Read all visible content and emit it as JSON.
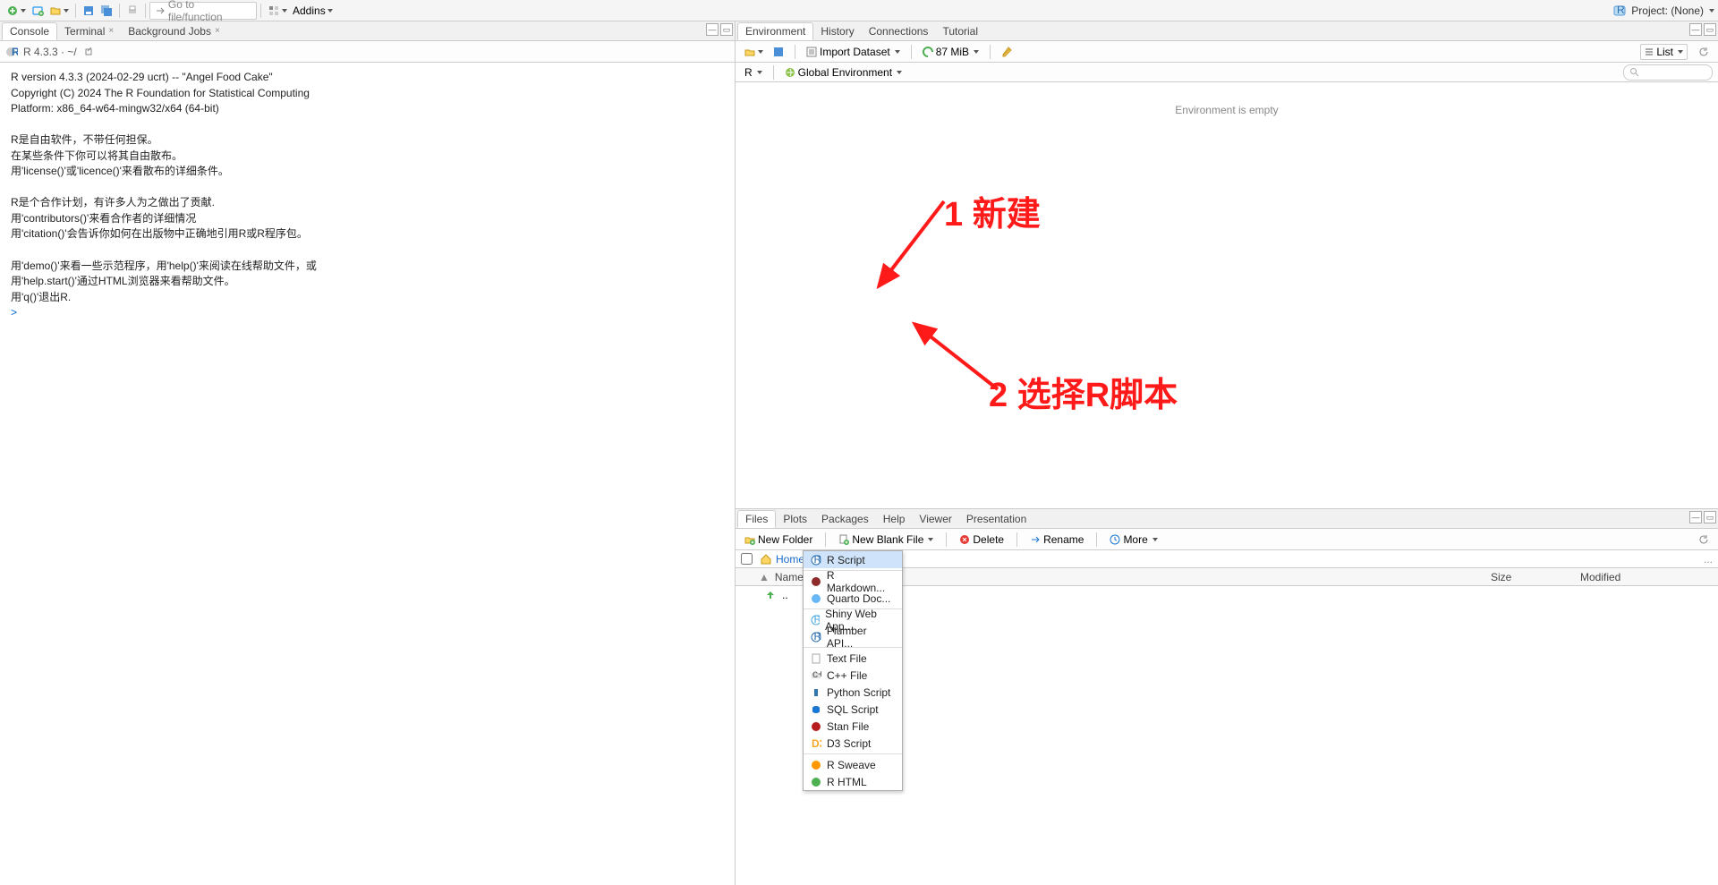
{
  "topbar": {
    "goto_placeholder": "Go to file/function",
    "addins": "Addins",
    "project": "Project: (None)"
  },
  "left_tabs": [
    "Console",
    "Terminal",
    "Background Jobs"
  ],
  "console_header": {
    "r_version_short": "R 4.3.3 · ~/"
  },
  "console_text": "R version 4.3.3 (2024-02-29 ucrt) -- \"Angel Food Cake\"\nCopyright (C) 2024 The R Foundation for Statistical Computing\nPlatform: x86_64-w64-mingw32/x64 (64-bit)\n\nR是自由软件，不带任何担保。\n在某些条件下你可以将其自由散布。\n用'license()'或'licence()'来看散布的详细条件。\n\nR是个合作计划，有许多人为之做出了贡献.\n用'contributors()'来看合作者的详细情况\n用'citation()'会告诉你如何在出版物中正确地引用R或R程序包。\n\n用'demo()'来看一些示范程序，用'help()'来阅读在线帮助文件，或\n用'help.start()'通过HTML浏览器来看帮助文件。\n用'q()'退出R.\n",
  "prompt": "> ",
  "env_tabs": [
    "Environment",
    "History",
    "Connections",
    "Tutorial"
  ],
  "env_toolbar": {
    "import": "Import Dataset",
    "mem": "87 MiB"
  },
  "env_toolbar2": {
    "scope": "R",
    "env_sel": "Global Environment"
  },
  "env_empty": "Environment is empty",
  "env_list_btn": "List",
  "files_tabs": [
    "Files",
    "Plots",
    "Packages",
    "Help",
    "Viewer",
    "Presentation"
  ],
  "files_toolbar": {
    "new_folder": "New Folder",
    "new_blank": "New Blank File",
    "delete": "Delete",
    "rename": "Rename",
    "more": "More"
  },
  "breadcrumb": {
    "home": "Home"
  },
  "file_headers": {
    "name": "Name",
    "size": "Size",
    "modified": "Modified"
  },
  "file_row_up": "..",
  "dropdown_items": [
    "R Script",
    "R Markdown...",
    "Quarto Doc...",
    "Shiny Web App...",
    "Plumber API...",
    "Text File",
    "C++ File",
    "Python Script",
    "SQL Script",
    "Stan File",
    "D3 Script",
    "R Sweave",
    "R HTML"
  ],
  "annot1": "1 新建",
  "annot2": "2 选择R脚本"
}
